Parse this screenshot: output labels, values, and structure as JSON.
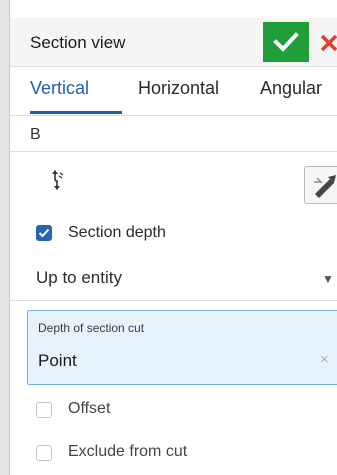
{
  "header": {
    "title": "Section view"
  },
  "tabs": [
    {
      "label": "Vertical",
      "active": true
    },
    {
      "label": "Horizontal",
      "active": false
    },
    {
      "label": "Angular",
      "active": false
    }
  ],
  "view_field": {
    "value": "B"
  },
  "icons": {
    "confirm": "check-icon",
    "cancel": "close-icon",
    "flip": "flip-direction-icon",
    "tool": "sketch-arrow-icon"
  },
  "section_depth": {
    "label": "Section depth",
    "checked": true
  },
  "depth_mode": {
    "selected": "Up to entity",
    "arrow": "▼"
  },
  "depth_of_cut": {
    "label": "Depth of section cut",
    "value": "Point",
    "clear_glyph": "×"
  },
  "offset": {
    "label": "Offset",
    "checked": false
  },
  "exclude_from_cut": {
    "label": "Exclude from cut",
    "checked": false
  },
  "colors": {
    "accent": "#1f5fb2",
    "confirm_green": "#1f9e3a",
    "cancel_red": "#e0402a",
    "selection_bg": "#e8f2fc",
    "selection_border": "#7aaee6"
  }
}
